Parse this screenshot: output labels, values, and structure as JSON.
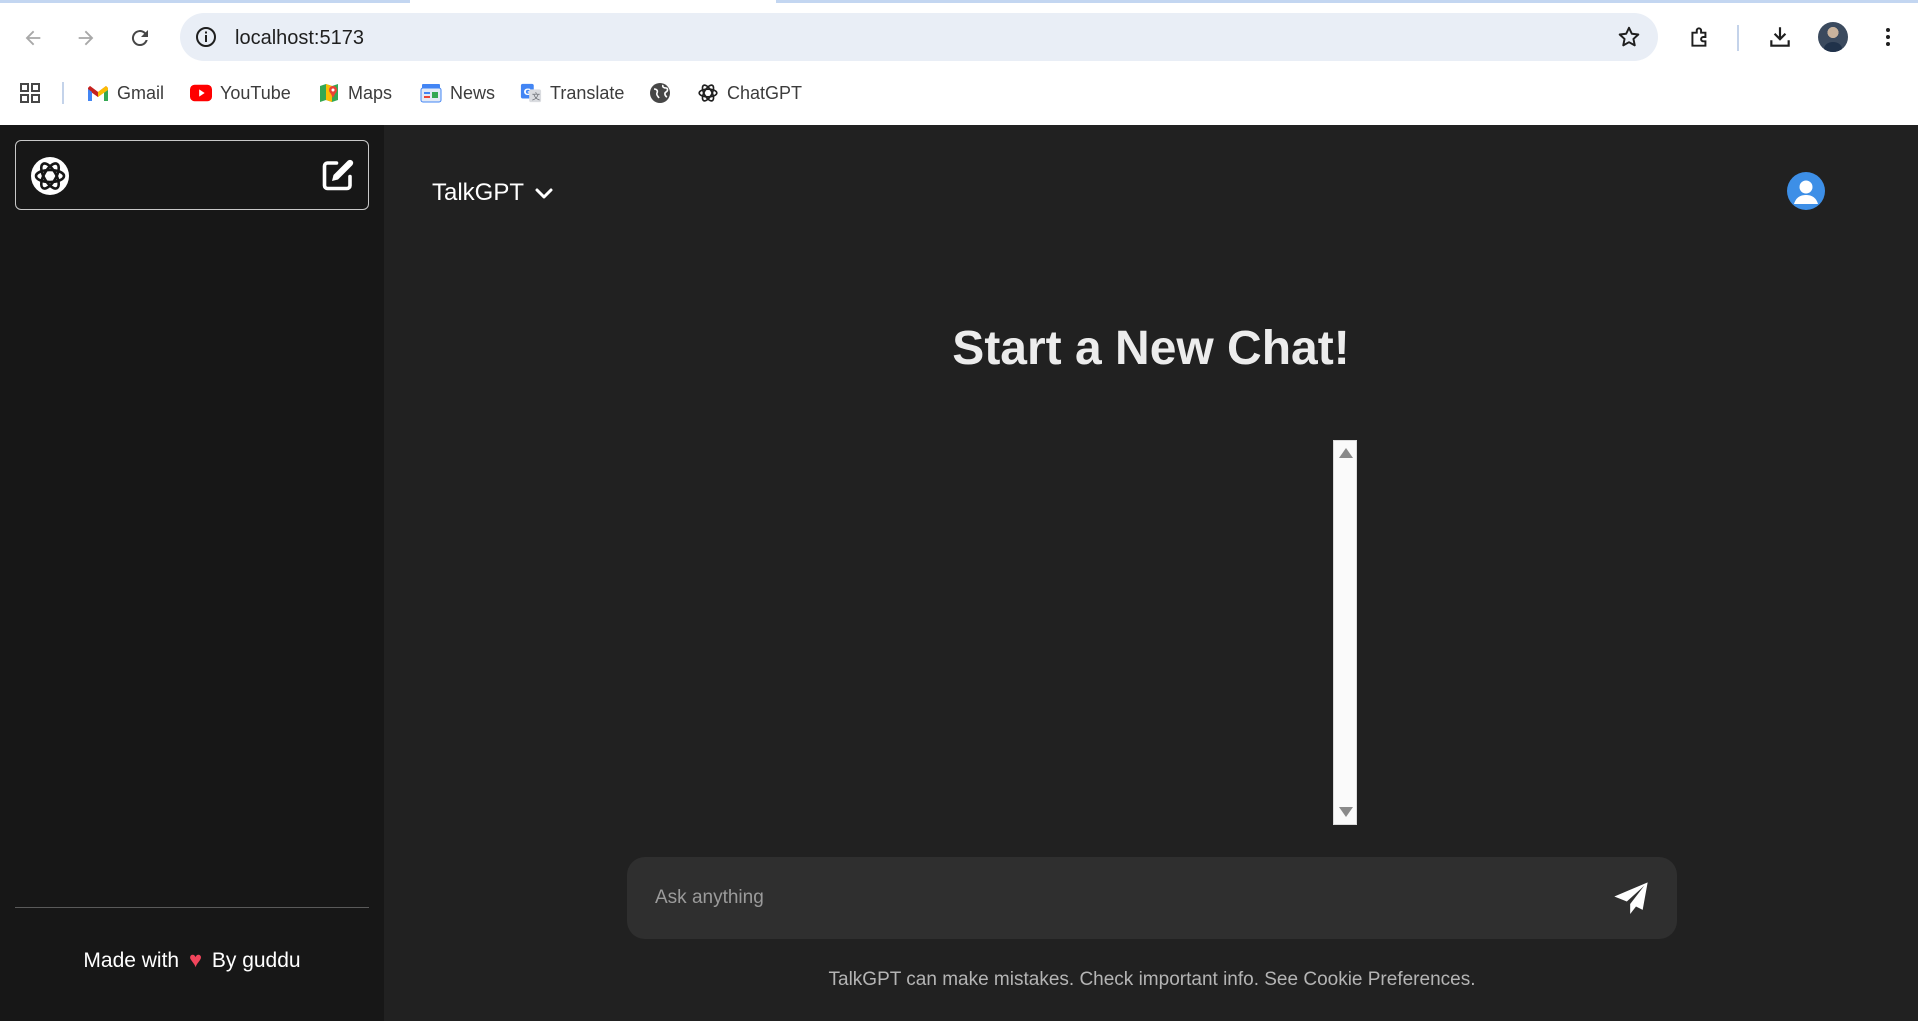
{
  "browser": {
    "url": "localhost:5173",
    "bookmarks": [
      {
        "label": "Gmail",
        "icon": "gmail-icon"
      },
      {
        "label": "YouTube",
        "icon": "youtube-icon"
      },
      {
        "label": "Maps",
        "icon": "maps-icon"
      },
      {
        "label": "News",
        "icon": "news-icon"
      },
      {
        "label": "Translate",
        "icon": "translate-icon"
      },
      {
        "label": "",
        "icon": "globe-icon"
      },
      {
        "label": "ChatGPT",
        "icon": "chatgpt-icon"
      }
    ]
  },
  "sidebar": {
    "footer_prefix": "Made with",
    "footer_heart": "♥",
    "footer_suffix": "By guddu"
  },
  "header": {
    "model_name": "TalkGPT"
  },
  "main": {
    "heading": "Start a New Chat!"
  },
  "composer": {
    "placeholder": "Ask anything",
    "value": ""
  },
  "footer": {
    "disclaimer": "TalkGPT can make mistakes. Check important info. See Cookie Preferences."
  },
  "colors": {
    "accent_user": "#3d8fe7",
    "sidebar_bg": "#171717",
    "main_bg": "#212121",
    "heart": "#f2455c"
  }
}
